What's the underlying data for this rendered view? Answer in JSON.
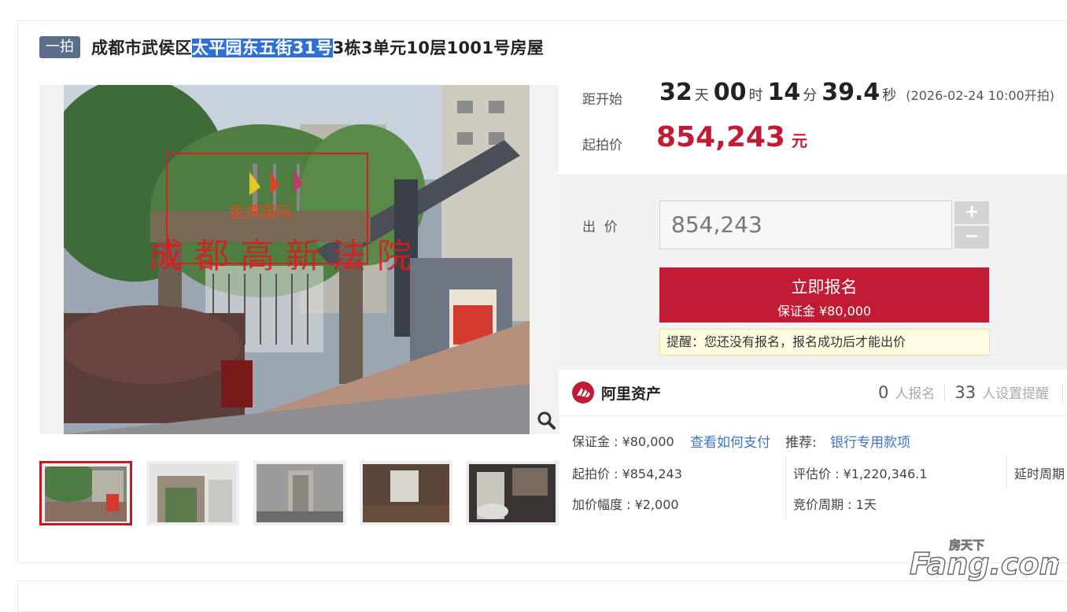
{
  "title": {
    "tag": "一拍",
    "prefix": "成都市武侯区",
    "highlight": "太平园东五街31号",
    "suffix": "3栋3单元10层1001号房屋"
  },
  "photo_overlay": {
    "estate_sign": "金牌国际",
    "court_watermark": "成 都 高 新 法 院"
  },
  "countdown": {
    "label": "距开始",
    "days": "32",
    "days_unit": "天",
    "hours": "00",
    "hours_unit": "时",
    "minutes": "14",
    "minutes_unit": "分",
    "seconds": "39.4",
    "seconds_unit": "秒",
    "start_note": "(2026-02-24 10:00开拍)"
  },
  "start_price": {
    "label": "起拍价",
    "value": "854,243",
    "unit": "元"
  },
  "bid": {
    "label": "出  价",
    "input_value": "854,243",
    "plus": "+",
    "minus": "−",
    "signup_label": "立即报名",
    "deposit_label": "保证金 ¥80,000",
    "notice": "提醒：您还没有报名，报名成功后才能出价"
  },
  "platform": {
    "name": "阿里资产",
    "signup_count": "0",
    "signup_label": "人报名",
    "reminder_count": "33",
    "reminder_label": "人设置提醒"
  },
  "details": {
    "deposit": "保证金 : ¥80,000",
    "pay_link": "查看如何支付",
    "recommend_label": "推荐:",
    "recommend_link": "银行专用款项",
    "start_price": "起拍价 : ¥854,243",
    "appraisal": "评估价 : ¥1,220,346.1",
    "delay": "延时周期",
    "increment": "加价幅度 : ¥2,000",
    "cycle": "竞价周期 : 1天"
  },
  "watermark": {
    "text_top": "房天下",
    "text_main": "Fang.com"
  },
  "colors": {
    "accent_red": "#c21b35",
    "tag_bg": "#5a6e8c",
    "link_blue": "#3b74c8",
    "highlight_blue": "#2f6fd6"
  }
}
